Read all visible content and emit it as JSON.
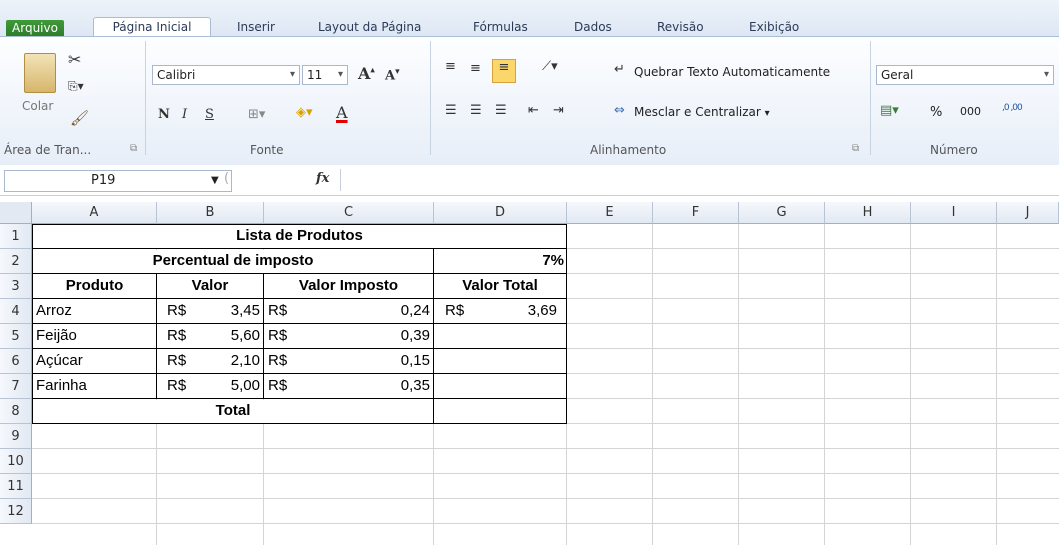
{
  "ribbon_tabs": [
    "Arquivo",
    "Página Inicial",
    "Inserir",
    "Layout da Página",
    "Fórmulas",
    "Dados",
    "Revisão",
    "Exibição"
  ],
  "clipboard": {
    "paste": "Colar",
    "group": "Área de Tran..."
  },
  "font": {
    "name": "Calibri",
    "size": "11",
    "bold": "N",
    "italic": "I",
    "underline": "S",
    "group": "Fonte"
  },
  "alignment": {
    "wrap": "Quebrar Texto Automaticamente",
    "merge": "Mesclar e Centralizar",
    "group": "Alinhamento"
  },
  "number": {
    "format": "Geral",
    "percent": "%",
    "thousands": "000",
    "inc": ",0 ,00",
    "group": "Número"
  },
  "formula_bar": {
    "cell_ref": "P19",
    "fx": "fx",
    "content": ""
  },
  "columns": [
    "A",
    "B",
    "C",
    "D",
    "E",
    "F",
    "G",
    "H",
    "I",
    "J"
  ],
  "rows": [
    "1",
    "2",
    "3",
    "4",
    "5",
    "6",
    "7",
    "8",
    "9",
    "10",
    "11",
    "12"
  ],
  "sheet": {
    "title": "Lista de Produtos",
    "tax_label": "Percentual de imposto",
    "tax_value": "7%",
    "headers": {
      "produto": "Produto",
      "valor": "Valor",
      "imposto": "Valor Imposto",
      "total": "Valor Total"
    },
    "currency": "R$",
    "products": [
      {
        "name": "Arroz",
        "valor": "3,45",
        "imposto": "0,24",
        "total": "3,69"
      },
      {
        "name": "Feijão",
        "valor": "5,60",
        "imposto": "0,39",
        "total": ""
      },
      {
        "name": "Açúcar",
        "valor": "2,10",
        "imposto": "0,15",
        "total": ""
      },
      {
        "name": "Farinha",
        "valor": "5,00",
        "imposto": "0,35",
        "total": ""
      }
    ],
    "total_label": "Total"
  }
}
